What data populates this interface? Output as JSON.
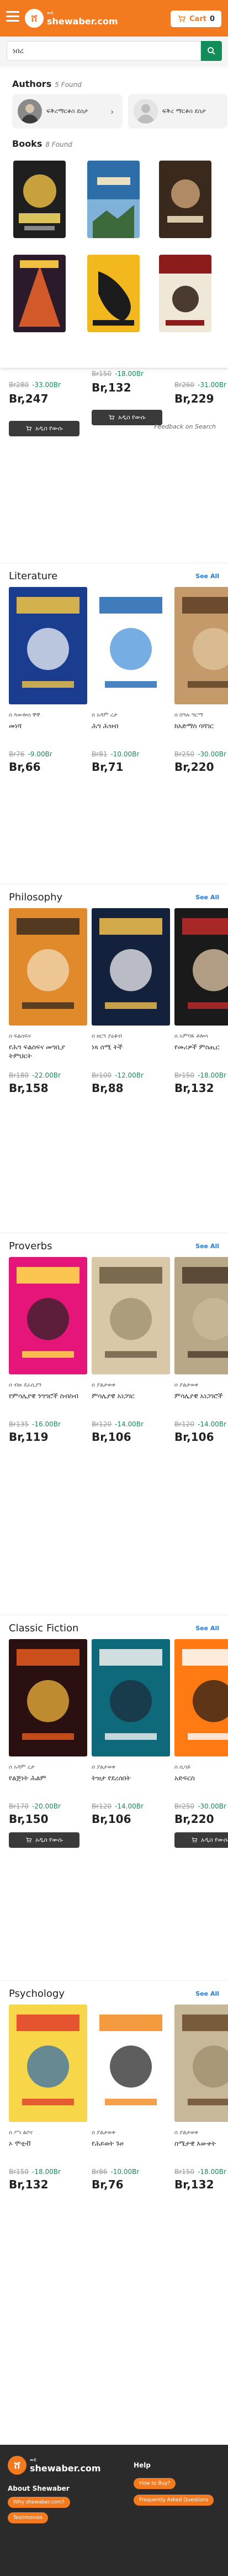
{
  "header": {
    "logo_small": "ወደ",
    "logo_big": "shewaber.com",
    "cart_label": "Cart",
    "cart_count": "0"
  },
  "search": {
    "value": "ነበረ",
    "placeholder": "Search"
  },
  "dropdown": {
    "authors_title": "Authors",
    "authors_count": "5 Found",
    "authors": [
      {
        "name": "ፍቅረማርቆስ ደስታ"
      },
      {
        "name": "ፍቅረ ማርቆስ ደስታ"
      }
    ],
    "books_title": "Books",
    "books_count": "8 Found",
    "footer": "Feedback on Search"
  },
  "first_section": {
    "prices": [
      {
        "old": "Br280",
        "disc": "-33.00Br",
        "now": "Br,247"
      },
      {
        "old": "Br150",
        "disc": "-18.00Br",
        "now": "Br,132"
      },
      {
        "old": "Br260",
        "disc": "-31.00Br",
        "now": "Br,229"
      }
    ],
    "cart_label": "አዲስ የውሱ"
  },
  "sections": [
    {
      "title": "Literature",
      "see_all": "See All",
      "books": [
        {
          "author": "ሰ ጳውሎስ ኞኞ",
          "title": "መነሻ",
          "old": "Br76",
          "disc": "-9.00Br",
          "now": "Br,66"
        },
        {
          "author": "ሰ አዳም ረታ",
          "title": "ሕግ ሕዝብ",
          "old": "Br81",
          "disc": "-10.00Br",
          "now": "Br,71"
        },
        {
          "author": "ሰ በዓሉ ግርማ",
          "title": "ከአድማስ ባሻገር",
          "old": "Br250",
          "disc": "-30.00Br",
          "now": "Br,220"
        }
      ]
    },
    {
      "title": "Philosophy",
      "see_all": "See All",
      "books": [
        {
          "author": "ሰ ፍልስፍና",
          "title": "የሕግ ፍልስፍና መግቢያ ትምህርት",
          "old": "Br180",
          "disc": "-22.00Br",
          "now": "Br,158"
        },
        {
          "author": "ሰ ዘርዓ ያዕቆብ",
          "title": "ነጻ ሰሚ ትች",
          "old": "Br100",
          "disc": "-12.00Br",
          "now": "Br,88"
        },
        {
          "author": "ሰ አምባዬ ቶሎሳ",
          "title": "የመሪዎች ምስጢር",
          "old": "Br150",
          "disc": "-18.00Br",
          "now": "Br,132"
        }
      ]
    },
    {
      "title": "Proverbs",
      "see_all": "See All",
      "books": [
        {
          "author": "ሰ ብዙ ደራሲያን",
          "title": "የምሳሌያዊ ንግግሮች ስብስብ",
          "old": "Br135",
          "disc": "-16.00Br",
          "now": "Br,119"
        },
        {
          "author": "ሰ ያልታወቀ",
          "title": "ምሳሌያዊ አነጋገር",
          "old": "Br120",
          "disc": "-14.00Br",
          "now": "Br,106"
        },
        {
          "author": "ሰ ያልታወቀ",
          "title": "ምሳሌያዊ አነጋገሮች",
          "old": "Br120",
          "disc": "-14.00Br",
          "now": "Br,106"
        }
      ]
    },
    {
      "title": "Classic Fiction",
      "see_all": "See All",
      "books": [
        {
          "author": "ሰ አዳም ረታ",
          "title": "የልጅነት ሕልም",
          "old": "Br170",
          "disc": "-20.00Br",
          "now": "Br,150"
        },
        {
          "author": "ሰ ያልታወቀ",
          "title": "ትዝታ የደረሰበት",
          "old": "Br120",
          "disc": "-14.00Br",
          "now": "Br,106"
        },
        {
          "author": "ሰ ሲሳይ",
          "title": "አድፍርስ",
          "old": "Br250",
          "disc": "-30.00Br",
          "now": "Br,220"
        }
      ],
      "cart_label": "አዲስ የውሱ"
    },
    {
      "title": "Psychology",
      "see_all": "See All",
      "books": [
        {
          "author": "ሰ ሥነ ልቦና",
          "title": "ኦ ሞቲቭ",
          "old": "Br150",
          "disc": "-18.00Br",
          "now": "Br,132"
        },
        {
          "author": "ሰ ያልታወቀ",
          "title": "የሕይወት ጉዞ",
          "old": "Br86",
          "disc": "-10.00Br",
          "now": "Br,76"
        },
        {
          "author": "ሰ ያልታወቀ",
          "title": "ስሜታዊ እውቀት",
          "old": "Br150",
          "disc": "-18.00Br",
          "now": "Br,132"
        }
      ]
    }
  ],
  "footer": {
    "logo_small": "ወደ",
    "logo_big": "shewaber.com",
    "about_title": "About Shewaber",
    "about_link": "Why shewaber.com?",
    "testimonials": "Testimonies",
    "help_title": "Help",
    "howto": "How to Buy?",
    "faq": "Frequently Asked Questions"
  },
  "colors": {
    "brand": "#f47a1f",
    "search_button": "#128c58",
    "discount": "#128c58",
    "see_all": "#1e7ad8",
    "footer_bg": "#2b2b2b"
  }
}
